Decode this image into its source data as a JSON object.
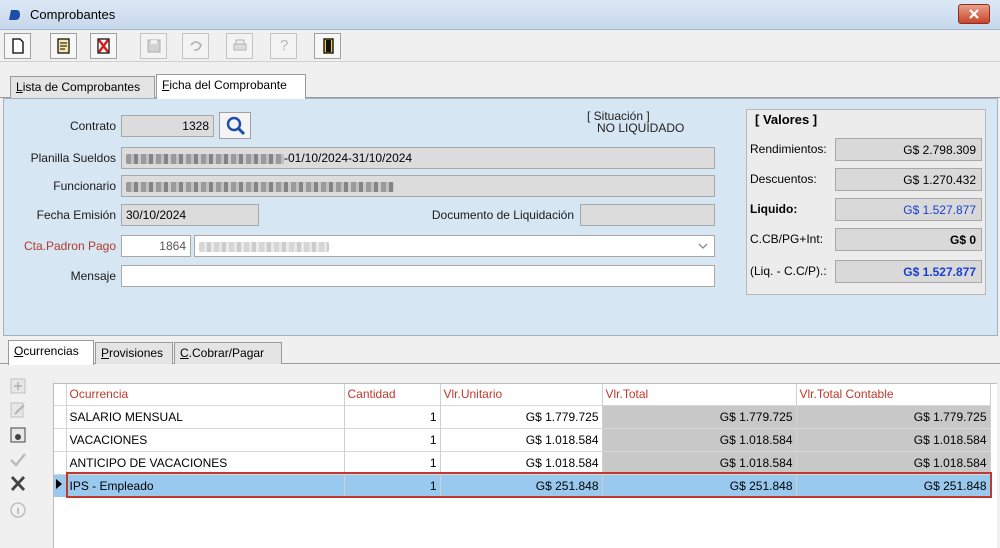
{
  "window": {
    "title": "Comprobantes",
    "close_label": "x"
  },
  "toolbar": {
    "buttons": [
      {
        "icon": "new-document-icon",
        "enabled": true
      },
      {
        "icon": "edit-document-icon",
        "enabled": true
      },
      {
        "icon": "delete-icon",
        "enabled": true
      },
      {
        "icon": "save-icon",
        "enabled": false
      },
      {
        "icon": "undo-icon",
        "enabled": false
      },
      {
        "icon": "print-icon",
        "enabled": false
      },
      {
        "icon": "help-icon",
        "enabled": false,
        "glyph": "?"
      },
      {
        "icon": "exit-door-icon",
        "enabled": true
      }
    ]
  },
  "top_tabs": [
    {
      "label": "Lista de Comprobantes",
      "active": false
    },
    {
      "label": "Ficha del Comprobante",
      "active": true
    }
  ],
  "ficha": {
    "contrato_label": "Contrato",
    "contrato_value": "1328",
    "situacion_caption": "[ Situación ]",
    "situacion_value": "NO LIQUIDADO",
    "planilla_label": "Planilla Sueldos",
    "planilla_suffix": "-01/10/2024-31/10/2024",
    "funcionario_label": "Funcionario",
    "fecha_emision_label": "Fecha Emisión",
    "fecha_emision_value": "30/10/2024",
    "documento_label": "Documento de Liquidación",
    "documento_value": "",
    "cta_padron_label": "Cta.Padron Pago",
    "cta_padron_value": "1864",
    "mensaje_label": "Mensaje",
    "mensaje_value": ""
  },
  "valores": {
    "header": "[ Valores ]",
    "rendimientos_label": "Rendimientos:",
    "rendimientos_value": "G$ 2.798.309",
    "descuentos_label": "Descuentos:",
    "descuentos_value": "G$ 1.270.432",
    "liquido_label": "Liquido:",
    "liquido_value": "G$ 1.527.877",
    "ccb_label": "C.CB/PG+Int:",
    "ccb_value": "G$ 0",
    "liq_cc_label": "(Liq. - C.C/P).:",
    "liq_cc_value": "G$ 1.527.877"
  },
  "bottom_tabs": [
    {
      "label": "Ocurrencias",
      "active": true
    },
    {
      "label": "Provisiones",
      "active": false
    },
    {
      "label": "C.Cobrar/Pagar",
      "active": false
    }
  ],
  "side_actions": [
    {
      "icon": "add-row-icon",
      "enabled": false
    },
    {
      "icon": "edit-row-icon",
      "enabled": false
    },
    {
      "icon": "remove-row-icon",
      "enabled": true
    },
    {
      "icon": "confirm-check-icon",
      "enabled": false
    },
    {
      "icon": "cancel-x-icon",
      "enabled": true
    },
    {
      "icon": "info-icon",
      "enabled": false
    }
  ],
  "grid": {
    "columns": [
      "Ocurrencia",
      "Cantidad",
      "Vlr.Unitario",
      "Vlr.Total",
      "Vlr.Total Contable"
    ],
    "rows": [
      {
        "ocurrencia": "SALARIO MENSUAL",
        "cantidad": "1",
        "unitario": "G$ 1.779.725",
        "total": "G$ 1.779.725",
        "contable": "G$ 1.779.725"
      },
      {
        "ocurrencia": "VACACIONES",
        "cantidad": "1",
        "unitario": "G$ 1.018.584",
        "total": "G$ 1.018.584",
        "contable": "G$ 1.018.584"
      },
      {
        "ocurrencia": "ANTICIPO DE VACACIONES",
        "cantidad": "1",
        "unitario": "G$ 1.018.584",
        "total": "G$ 1.018.584",
        "contable": "G$ 1.018.584"
      },
      {
        "ocurrencia": "IPS - Empleado",
        "cantidad": "1",
        "unitario": "G$ 251.848",
        "total": "G$ 251.848",
        "contable": "G$ 251.848"
      }
    ],
    "selected_row": 3
  },
  "colors": {
    "panel_bg": "#d7e6f3",
    "accent_red": "#c0392b",
    "selected_row": "#99c9ef",
    "link_blue": "#1a3fd1"
  }
}
